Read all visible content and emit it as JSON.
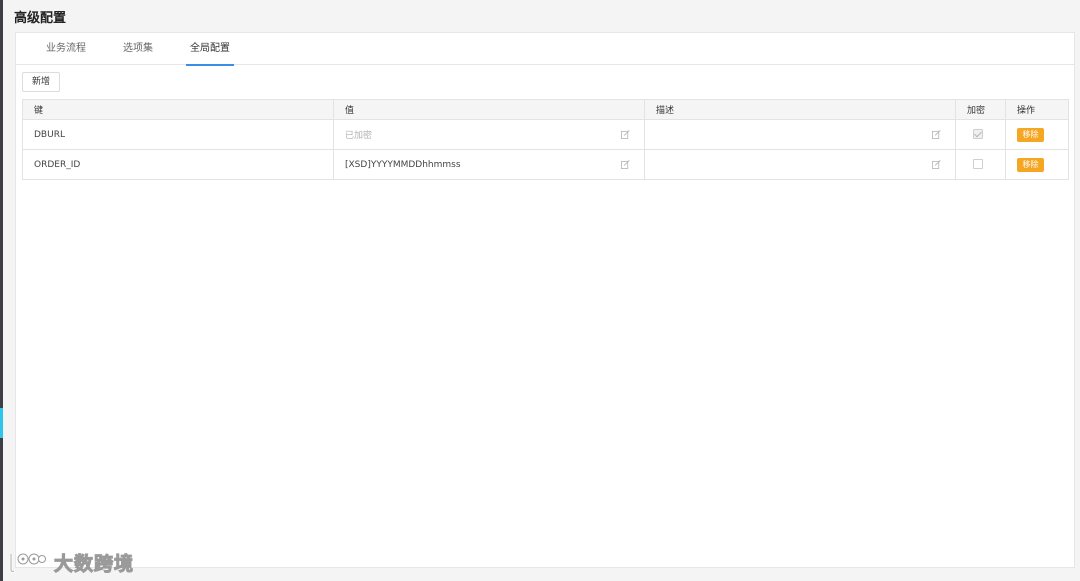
{
  "page_title": "高级配置",
  "tabs": [
    {
      "label": "业务流程",
      "active": false
    },
    {
      "label": "选项集",
      "active": false
    },
    {
      "label": "全局配置",
      "active": true
    }
  ],
  "toolbar": {
    "add_label": "新增"
  },
  "table": {
    "headers": [
      "键",
      "值",
      "描述",
      "加密",
      "操作"
    ],
    "rows": [
      {
        "key": "DBURL",
        "value": "已加密",
        "value_is_placeholder": true,
        "description": "",
        "encrypted": true,
        "action_label": "移除"
      },
      {
        "key": "ORDER_ID",
        "value": "[XSD]YYYYMMDDhhmmss",
        "value_is_placeholder": false,
        "description": "",
        "encrypted": false,
        "action_label": "移除"
      }
    ]
  },
  "colors": {
    "accent": "#3a8ee6",
    "remove_button": "#f5a623",
    "sidebar_accent": "#2fc5e8"
  },
  "watermark": {
    "text": "大数跨境"
  }
}
